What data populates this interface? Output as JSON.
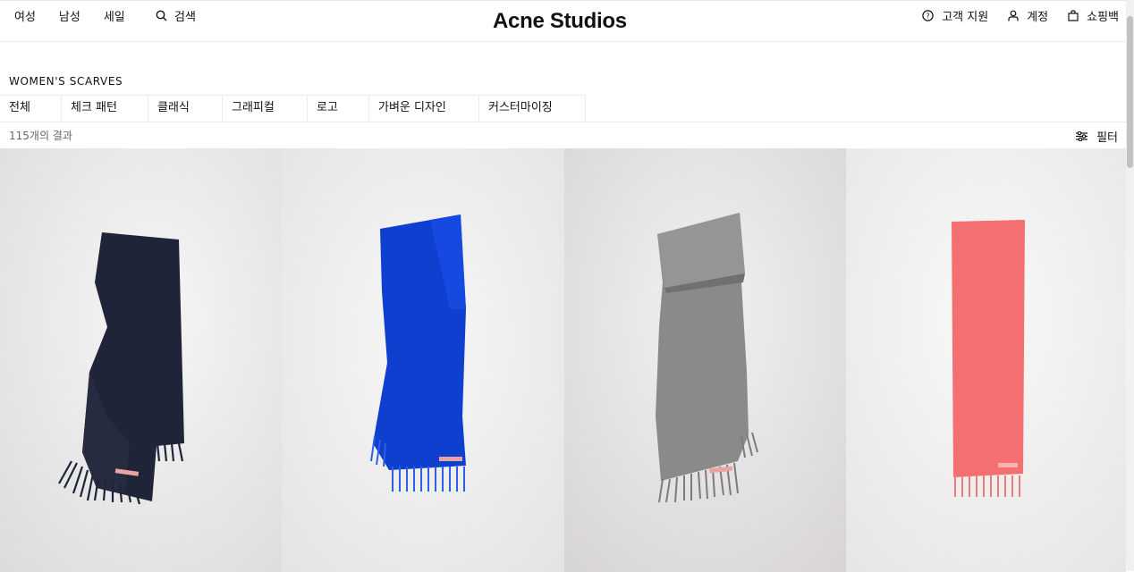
{
  "header": {
    "nav_left": [
      "여성",
      "남성",
      "세일"
    ],
    "search_label": "검색",
    "logo": "Acne Studios",
    "support_label": "고객 지원",
    "account_label": "계정",
    "bag_label": "쇼핑백"
  },
  "page": {
    "heading": "WOMEN'S SCARVES",
    "tabs": [
      "전체",
      "체크 패턴",
      "클래식",
      "그래피컬",
      "로고",
      "가벼운 디자인",
      "커스터마이징"
    ],
    "results_text": "115개의 결과",
    "filter_label": "필터"
  },
  "products": [
    {
      "name": "navy-scarf",
      "color": "#1f2438",
      "background": "#ececec"
    },
    {
      "name": "blue-scarf",
      "color": "#0f3fcf",
      "background": "#ebebeb"
    },
    {
      "name": "grey-scarf",
      "color": "#8a8a8a",
      "background": "#e6e4e6"
    },
    {
      "name": "pink-scarf",
      "color": "#f46f6f",
      "background": "#f0efef"
    }
  ]
}
